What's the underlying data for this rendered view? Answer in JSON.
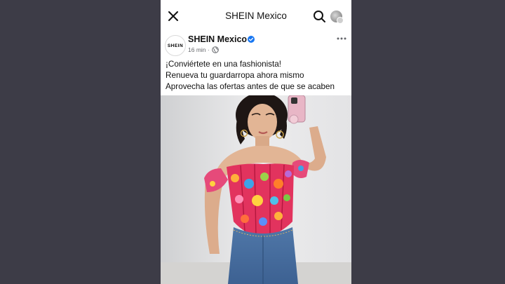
{
  "topbar": {
    "title": "SHEIN Mexico",
    "close_icon": "close-icon",
    "search_icon": "search-icon"
  },
  "post": {
    "author": {
      "name": "SHEIN Mexico",
      "avatar_text": "SHEIN",
      "verified": true
    },
    "time": "16 min ·",
    "privacy_icon": "globe-icon",
    "lines": [
      "¡Conviértete en una fashionista!",
      "Renueva tu guardarropa ahora mismo",
      "Aprovecha las ofertas antes de que se acaben"
    ],
    "image": {
      "subject": "woman taking mirror selfie in red floral off-shoulder corset top and jeans"
    }
  },
  "colors": {
    "backdrop": "#3d3c47",
    "verified_blue": "#1877f2",
    "secondary_text": "#65676b"
  }
}
